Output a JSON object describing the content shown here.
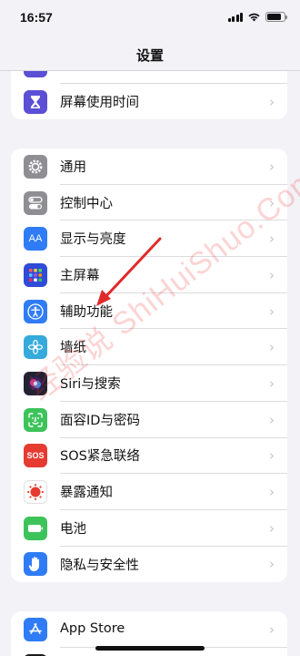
{
  "status_bar": {
    "time": "16:57"
  },
  "nav": {
    "title": "设置"
  },
  "group_top": {
    "items": [
      {
        "label": "",
        "color": "#5b4fd6",
        "icon": "focus-icon"
      },
      {
        "label": "屏幕使用时间",
        "color": "#5b4fd6",
        "icon": "hourglass-icon"
      }
    ]
  },
  "group_main": {
    "items": [
      {
        "label": "通用",
        "color": "#8e8e93",
        "icon": "gear-icon"
      },
      {
        "label": "控制中心",
        "color": "#8e8e93",
        "icon": "toggles-icon"
      },
      {
        "label": "显示与亮度",
        "color": "#2f7cf6",
        "icon_text": "AA",
        "icon": "display-icon"
      },
      {
        "label": "主屏幕",
        "color": "#2f4bd8",
        "icon": "home-grid-icon"
      },
      {
        "label": "辅助功能",
        "color": "#2f7cf6",
        "icon": "accessibility-icon"
      },
      {
        "label": "墙纸",
        "color": "#35aadc",
        "icon": "flower-icon"
      },
      {
        "label": "Siri与搜索",
        "color": "#222233",
        "icon": "siri-icon"
      },
      {
        "label": "面容ID与密码",
        "color": "#3cc35a",
        "icon": "face-id-icon"
      },
      {
        "label": "SOS紧急联络",
        "color": "#e53b30",
        "icon_text": "SOS",
        "icon": "sos-icon"
      },
      {
        "label": "暴露通知",
        "color": "#ffffff",
        "icon": "exposure-icon"
      },
      {
        "label": "电池",
        "color": "#3cc35a",
        "icon": "battery-icon"
      },
      {
        "label": "隐私与安全性",
        "color": "#2f7cf6",
        "icon": "hand-icon"
      }
    ]
  },
  "group_bottom": {
    "items": [
      {
        "label": "App Store",
        "color": "#2f7cf6",
        "icon": "app-store-icon"
      }
    ]
  },
  "watermark": {
    "text": "经验说 ShiHuiShuo.Com"
  }
}
